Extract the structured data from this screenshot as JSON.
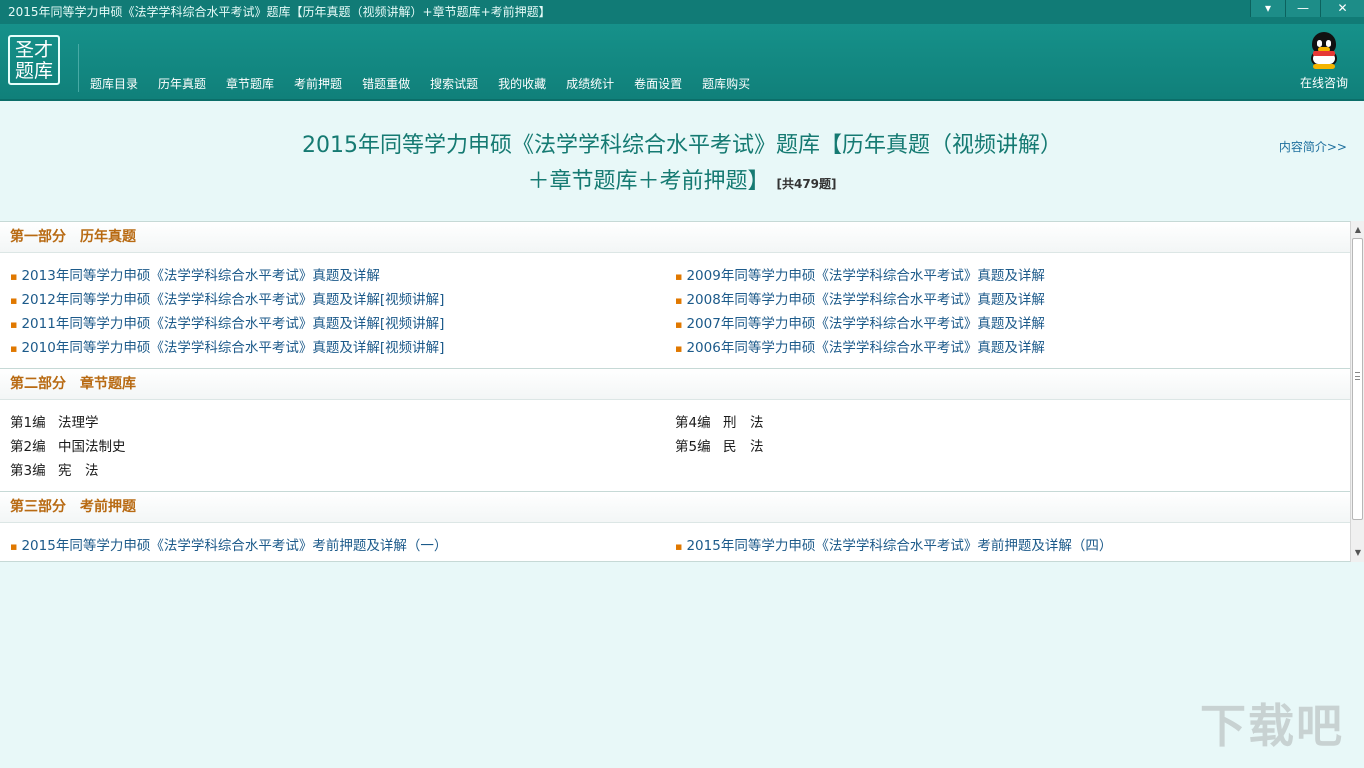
{
  "window": {
    "title": "2015年同等学力申硕《法学学科综合水平考试》题库【历年真题（视频讲解）+章节题库+考前押题】",
    "buttons": {
      "menu": "▾",
      "minimize": "—",
      "close": "✕"
    }
  },
  "logo": {
    "line1": "圣才",
    "line2": "题库"
  },
  "nav": [
    "题库目录",
    "历年真题",
    "章节题库",
    "考前押题",
    "错题重做",
    "搜索试题",
    "我的收藏",
    "成绩统计",
    "卷面设置",
    "题库购买"
  ],
  "consult": {
    "label": "在线咨询",
    "icon": "qq-penguin-icon"
  },
  "header": {
    "title_line1": "2015年同等学力申硕《法学学科综合水平考试》题库【历年真题（视频讲解）",
    "title_line2": "＋章节题库＋考前押题】",
    "count": "[共479题]",
    "intro_link": "内容简介>>"
  },
  "sections": {
    "s1": {
      "label": "第一部分",
      "name": "历年真题",
      "left": [
        "2013年同等学力申硕《法学学科综合水平考试》真题及详解",
        "2012年同等学力申硕《法学学科综合水平考试》真题及详解[视频讲解]",
        "2011年同等学力申硕《法学学科综合水平考试》真题及详解[视频讲解]",
        "2010年同等学力申硕《法学学科综合水平考试》真题及详解[视频讲解]"
      ],
      "right": [
        "2009年同等学力申硕《法学学科综合水平考试》真题及详解",
        "2008年同等学力申硕《法学学科综合水平考试》真题及详解",
        "2007年同等学力申硕《法学学科综合水平考试》真题及详解",
        "2006年同等学力申硕《法学学科综合水平考试》真题及详解"
      ]
    },
    "s2": {
      "label": "第二部分",
      "name": "章节题库",
      "left": [
        {
          "num": "第1编",
          "name": "法理学"
        },
        {
          "num": "第2编",
          "name": "中国法制史"
        },
        {
          "num": "第3编",
          "name": "宪　法"
        }
      ],
      "right": [
        {
          "num": "第4编",
          "name": "刑　法"
        },
        {
          "num": "第5编",
          "name": "民　法"
        }
      ]
    },
    "s3": {
      "label": "第三部分",
      "name": "考前押题",
      "left": [
        "2015年同等学力申硕《法学学科综合水平考试》考前押题及详解（一）"
      ],
      "right": [
        "2015年同等学力申硕《法学学科综合水平考试》考前押题及详解（四）"
      ]
    }
  },
  "bullet": "▪",
  "watermark": "下载吧",
  "colors": {
    "header": "#117b76",
    "section_title": "#b86a12",
    "link": "#1c5a8a",
    "bullet": "#e07800"
  }
}
